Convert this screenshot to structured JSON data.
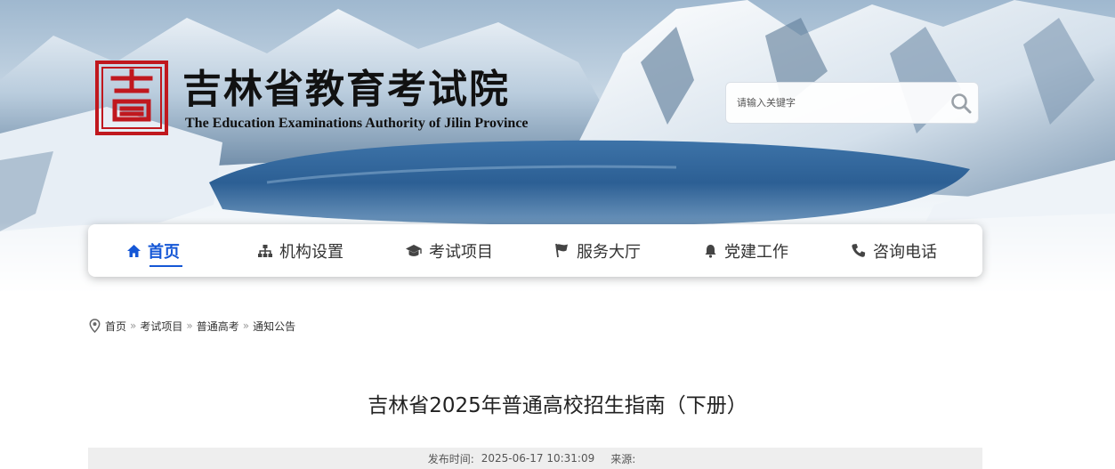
{
  "header": {
    "org_name_cn": "吉林省教育考试院",
    "org_name_en": "The Education Examinations Authority of Jilin Province",
    "seal_char": "吉",
    "seal_color": "#c0181e"
  },
  "search": {
    "placeholder": "请输入关键字",
    "icon": "search-icon"
  },
  "nav": {
    "accent_color": "#1557d6",
    "items": [
      {
        "label": "首页",
        "icon": "home-icon",
        "active": true
      },
      {
        "label": "机构设置",
        "icon": "sitemap-icon",
        "active": false
      },
      {
        "label": "考试项目",
        "icon": "graduation-cap-icon",
        "active": false
      },
      {
        "label": "服务大厅",
        "icon": "flag-icon",
        "active": false
      },
      {
        "label": "党建工作",
        "icon": "bell-icon",
        "active": false
      },
      {
        "label": "咨询电话",
        "icon": "phone-icon",
        "active": false
      }
    ]
  },
  "breadcrumb": {
    "icon": "location-pin-icon",
    "items": [
      "首页",
      "考试项目",
      "普通高考",
      "通知公告"
    ]
  },
  "article": {
    "title": "吉林省2025年普通高校招生指南（下册）",
    "publish_label": "发布时间:",
    "publish_time": "2025-06-17 10:31:09",
    "source_label": "来源:",
    "source": ""
  }
}
